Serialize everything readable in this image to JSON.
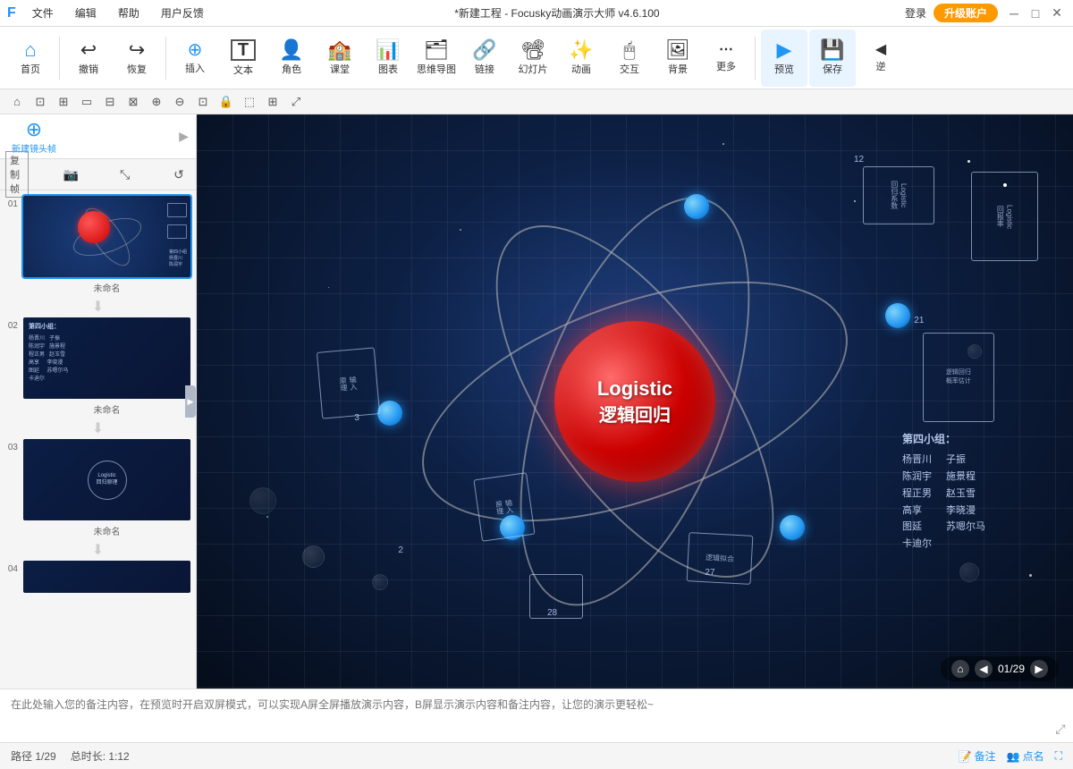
{
  "titlebar": {
    "menu": [
      "文件",
      "编辑",
      "帮助",
      "用户反馈"
    ],
    "title": "*新建工程 - Focusky动画演示大师 v4.6.100",
    "login_label": "登录",
    "upgrade_label": "升级账户",
    "win_controls": [
      "─",
      "□",
      "×"
    ]
  },
  "toolbar": {
    "items": [
      {
        "id": "home",
        "icon": "⌂",
        "label": "首页"
      },
      {
        "id": "undo",
        "icon": "↩",
        "label": "撤销"
      },
      {
        "id": "redo",
        "icon": "↪",
        "label": "恢复"
      },
      {
        "id": "insert",
        "icon": "⊕",
        "label": "插入"
      },
      {
        "id": "text",
        "icon": "T",
        "label": "文本"
      },
      {
        "id": "character",
        "icon": "👤",
        "label": "角色"
      },
      {
        "id": "class",
        "icon": "🎓",
        "label": "课堂"
      },
      {
        "id": "chart",
        "icon": "📊",
        "label": "图表"
      },
      {
        "id": "mindmap",
        "icon": "🧠",
        "label": "思维导图"
      },
      {
        "id": "link",
        "icon": "🔗",
        "label": "链接"
      },
      {
        "id": "slide",
        "icon": "📽",
        "label": "幻灯片"
      },
      {
        "id": "anim",
        "icon": "🎬",
        "label": "动画"
      },
      {
        "id": "interact",
        "icon": "🖱",
        "label": "交互"
      },
      {
        "id": "bg",
        "icon": "🖼",
        "label": "背景"
      },
      {
        "id": "more",
        "icon": "⋯",
        "label": "更多"
      },
      {
        "id": "preview",
        "icon": "▶",
        "label": "预览"
      },
      {
        "id": "save",
        "icon": "💾",
        "label": "保存"
      },
      {
        "id": "back",
        "icon": "◀",
        "label": "逆"
      }
    ]
  },
  "secondary_toolbar": {
    "buttons": [
      "⊡",
      "⊡",
      "⊡",
      "⊡",
      "⊡",
      "⊡",
      "⊕",
      "⊖",
      "⊡",
      "⊡",
      "⊡",
      "⊡",
      "⊡",
      "⊡"
    ]
  },
  "sidebar": {
    "new_frame_label": "新建镜头帧",
    "tools": [
      "□",
      "📷",
      "⤡",
      "↺"
    ],
    "slides": [
      {
        "num": "01",
        "label": "未命名",
        "active": true,
        "type": "atom"
      },
      {
        "num": "02",
        "label": "未命名",
        "active": false,
        "type": "team"
      },
      {
        "num": "03",
        "label": "未命名",
        "active": false,
        "type": "logistic"
      },
      {
        "num": "04",
        "label": "",
        "active": false,
        "type": "partial"
      }
    ]
  },
  "canvas": {
    "atom_title": "Logistic",
    "atom_subtitle": "逻辑回归",
    "frame_numbers": [
      "12",
      "3",
      "21",
      "2",
      "27",
      "28"
    ],
    "frame_labels": [
      "Logistic\n回归系数",
      "Logistic\n回报率",
      "输入\n原理",
      "逻辑拟合"
    ],
    "team_title": "第四小组：",
    "team_members_left": [
      "杨晋川",
      "陈润宇",
      "程正男",
      "高享",
      "图延",
      "卡迪尔"
    ],
    "team_members_right": [
      "子振",
      "施景程",
      "赵玉雪",
      "李晓漫",
      "苏嗯尔马"
    ],
    "nav_page": "01/29"
  },
  "notes": {
    "placeholder": "在此处输入您的备注内容，在预览时开启双屏模式，可以实现A屏全屏播放演示内容，B屏显示演示内容和备注内容，让您的演示更轻松~"
  },
  "statusbar": {
    "path": "路径 1/29",
    "total": "总时长: 1:12",
    "comment_label": "备注",
    "callname_label": "点名"
  }
}
